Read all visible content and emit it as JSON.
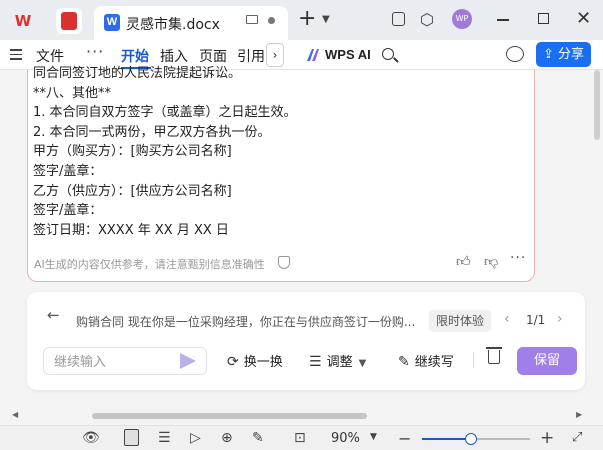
{
  "titlebar": {
    "app_logo": "W",
    "tab_icon_letter": "W",
    "tab_title": "灵感市集.docx",
    "avatar_text": "WP"
  },
  "menubar": {
    "items": [
      "文件",
      "开始",
      "插入",
      "页面",
      "引用"
    ],
    "ai_label": "WPS AI",
    "share_label": "分享"
  },
  "ai_output": {
    "lines": [
      "同合同签订地的人民法院提起诉讼。",
      "**八、其他**",
      "1. 本合同自双方签字（或盖章）之日起生效。",
      "2. 本合同一式两份，甲乙双方各执一份。",
      "甲方（购买方）：[购买方公司名称]",
      "签字/盖章：",
      "乙方（供应方）：[供应方公司名称]",
      "签字/盖章：",
      "签订日期：XXXX 年 XX 月 XX 日"
    ],
    "disclaimer": "AI生成的内容仅供参考，请注意甄别信息准确性"
  },
  "prompt_panel": {
    "title": "购销合同 现在你是一位采购经理，你正在与供应商签订一份购...",
    "badge": "限时体验",
    "pager": "1/1",
    "input_placeholder": "继续输入",
    "refresh_label": "换一换",
    "adjust_label": "调整",
    "continue_label": "继续写",
    "keep_label": "保留"
  },
  "statusbar": {
    "zoom": "90%",
    "zoom_fraction": 0.45
  },
  "colors": {
    "accent": "#1a57d6",
    "share": "#1a6ff0",
    "keep": "#a07fe8",
    "card_border": "#e8b4ad"
  }
}
